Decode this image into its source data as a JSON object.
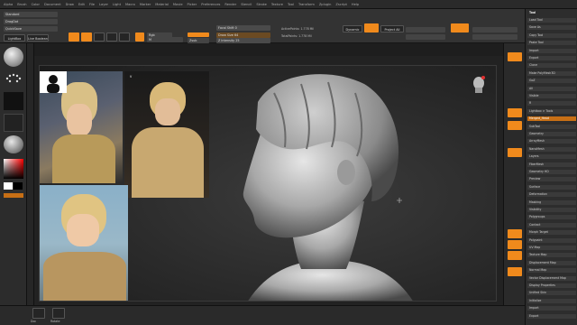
{
  "menu": {
    "items": [
      "Alpha",
      "Brush",
      "Color",
      "Document",
      "Draw",
      "Edit",
      "File",
      "Layer",
      "Light",
      "Macro",
      "Marker",
      "Material",
      "Movie",
      "Picker",
      "Preferences",
      "Render",
      "Stencil",
      "Stroke",
      "Texture",
      "Tool",
      "Transform",
      "Zplugin",
      "Zscript",
      "Help"
    ]
  },
  "toolbar": {
    "brush_label": "Standard",
    "focal_shift_label": "Focal Shift 0",
    "draw_size_label": "Draw Size 64",
    "z_intensity_label": "Z Intensity 25",
    "rgb_label": "Rgb",
    "mrgb_label": "Mrgb",
    "m_label": "M",
    "zadd_label": "Zadd",
    "zsub_label": "Zsub",
    "zcut_label": "Zcut",
    "edit_label": "Edit",
    "draw_label": "Draw",
    "move_label": "Move",
    "scale_label": "Scale",
    "rotate_label": "Rotate",
    "active_points_label": "ActivePoints: 1.778 Mil",
    "total_points_label": "TotalPoints: 1.778 Mil",
    "dynamic_label": "Dynamic",
    "project_label": "Project All",
    "lightbox_label": "LightBox",
    "live_boolean_label": "Live Boolean",
    "quick_save_label": "QuickSave"
  },
  "left_panel": {
    "brush_name": "Standard",
    "stroke_name": "DragDot",
    "alpha_name": "Alpha Off",
    "texture_name": "Texture Off",
    "material_name": "MatCap Gray",
    "gradient_label": "Gradient",
    "switch_color_label": "SwitchColor"
  },
  "right_panel": {
    "title": "Tool",
    "rows": [
      "Load Tool",
      "Save As",
      "Copy Tool",
      "Paste Tool",
      "Import",
      "Export",
      "Clone",
      "Make PolyMesh3D",
      "GoZ",
      "All",
      "Visible",
      "R",
      "Lightbox > Tools",
      "Merged_Head",
      "SubTool",
      "Geometry",
      "ArrayMesh",
      "NanoMesh",
      "Layers",
      "FiberMesh",
      "Geometry HD",
      "Preview",
      "Surface",
      "Deformation",
      "Masking",
      "Visibility",
      "Polygroups",
      "Contact",
      "Morph Target",
      "Polypaint",
      "UV Map",
      "Texture Map",
      "Displacement Map",
      "Normal Map",
      "Vector Displacement Map",
      "Display Properties",
      "Unified Skin",
      "Initialize",
      "Import",
      "Export"
    ],
    "highlight_index": 13
  },
  "bottom_bar": {
    "left_label": "Doc",
    "right_label": "Rotate"
  },
  "viewport": {
    "reference_label": "V"
  }
}
